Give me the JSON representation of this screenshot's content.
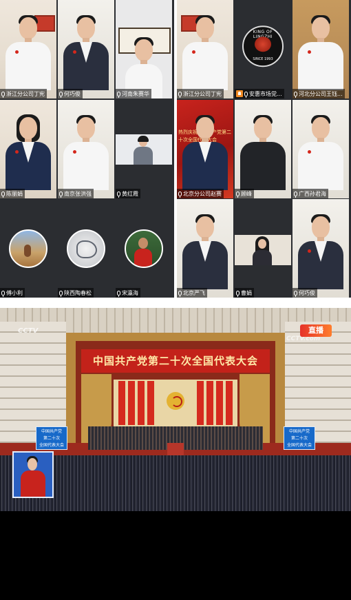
{
  "left_grid": {
    "tiles": [
      {
        "name": "浙江分公司丁宪",
        "mic": true
      },
      {
        "name": "何巧俊",
        "mic": true
      },
      {
        "name": "河南朱赛华",
        "mic": true
      },
      {
        "name": "陈丽娟",
        "mic": true
      },
      {
        "name": "南京张洪强",
        "mic": true
      },
      {
        "name": "黄红霞",
        "mic": true
      },
      {
        "name": "傅小利",
        "mic": true
      },
      {
        "name": "陕西陶春松",
        "mic": true
      },
      {
        "name": "宋瀛海",
        "mic": true
      }
    ]
  },
  "right_grid": {
    "tiles": [
      {
        "name": "浙江分公司丁宪",
        "mic": true
      },
      {
        "name": "安惠市场党...",
        "mic": true,
        "sharing": true,
        "logo_top": "KING OF LINGZHI",
        "logo_bottom": "SINCE 1993"
      },
      {
        "name": "河北分公司王钰...",
        "mic": true
      },
      {
        "name": "北京分公司赵赛",
        "mic": true,
        "banner": "热烈庆祝中国共产党第二十次全国代表大会"
      },
      {
        "name": "顾峰",
        "mic": true
      },
      {
        "name": "广西孙君海",
        "mic": true
      },
      {
        "name": "北京严飞",
        "mic": true
      },
      {
        "name": "曹娟",
        "mic": true
      },
      {
        "name": "何巧俊",
        "mic": true
      }
    ]
  },
  "broadcast": {
    "banner": "中国共产党第二十次全国代表大会",
    "sign_left": [
      "中国共产党",
      "第二十次",
      "全国代表大会"
    ],
    "sign_right": [
      "中国共产党",
      "第二十次",
      "全国代表大会"
    ],
    "logo_left": "CCTV",
    "logo_right": "CCTV.com",
    "live_label": "直播"
  },
  "colors": {
    "grid_bg": "#2b2d31",
    "banner_red": "#c3221a",
    "banner_text": "#ffe9a8",
    "live_badge": "#e5322a"
  }
}
